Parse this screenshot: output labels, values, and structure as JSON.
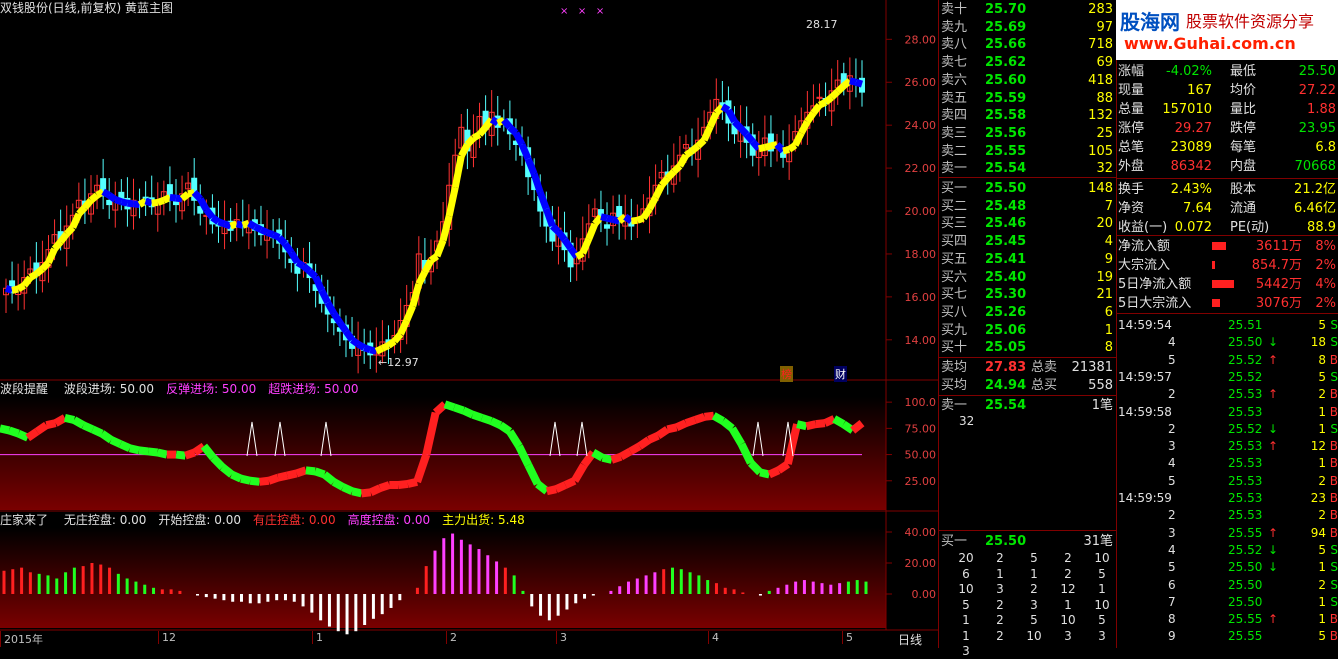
{
  "chart_title": "双钱股份(日线,前复权) 黄蓝主图",
  "main_axis": [
    "28.00",
    "26.00",
    "24.00",
    "22.00",
    "20.00",
    "18.00",
    "16.00",
    "14.00"
  ],
  "high_label": "28.17",
  "low_label": "12.97",
  "badges": [
    "榜",
    "财"
  ],
  "ind1": {
    "name": "波段提醒",
    "items": [
      {
        "t": "波段进场: 50.00",
        "c": "#e0e0e0"
      },
      {
        "t": "反弹进场: 50.00",
        "c": "#ff40ff"
      },
      {
        "t": "超跌进场: 50.00",
        "c": "#ff40ff"
      }
    ],
    "axis": [
      "100.0",
      "75.00",
      "50.00",
      "25.00"
    ]
  },
  "ind2": {
    "name": "庄家来了",
    "items": [
      {
        "t": "无庄控盘: 0.00",
        "c": "#e0e0e0"
      },
      {
        "t": "开始控盘: 0.00",
        "c": "#e0e0e0"
      },
      {
        "t": "有庄控盘: 0.00",
        "c": "#ff3030"
      },
      {
        "t": "高度控盘: 0.00",
        "c": "#ff40ff"
      },
      {
        "t": "主力出货: 5.48",
        "c": "#ffff00"
      }
    ],
    "axis": [
      "40.00",
      "20.00",
      "0.00"
    ]
  },
  "time_axis": {
    "labels": [
      "2015年",
      "12",
      "1",
      "2",
      "3",
      "4",
      "5"
    ],
    "period": "日线"
  },
  "logo": {
    "title": "股海网",
    "subtitle": "股票软件资源分享",
    "url": "www.Guhai.com.cn"
  },
  "sell": [
    {
      "l": "卖十",
      "p": "25.70",
      "v": "283"
    },
    {
      "l": "卖九",
      "p": "25.69",
      "v": "97"
    },
    {
      "l": "卖八",
      "p": "25.66",
      "v": "718"
    },
    {
      "l": "卖七",
      "p": "25.62",
      "v": "69"
    },
    {
      "l": "卖六",
      "p": "25.60",
      "v": "418"
    },
    {
      "l": "卖五",
      "p": "25.59",
      "v": "88"
    },
    {
      "l": "卖四",
      "p": "25.58",
      "v": "132"
    },
    {
      "l": "卖三",
      "p": "25.56",
      "v": "25"
    },
    {
      "l": "卖二",
      "p": "25.55",
      "v": "105"
    },
    {
      "l": "卖一",
      "p": "25.54",
      "v": "32"
    }
  ],
  "buy": [
    {
      "l": "买一",
      "p": "25.50",
      "v": "148"
    },
    {
      "l": "买二",
      "p": "25.48",
      "v": "7"
    },
    {
      "l": "买三",
      "p": "25.46",
      "v": "20"
    },
    {
      "l": "买四",
      "p": "25.45",
      "v": "4"
    },
    {
      "l": "买五",
      "p": "25.41",
      "v": "9"
    },
    {
      "l": "买六",
      "p": "25.40",
      "v": "19"
    },
    {
      "l": "买七",
      "p": "25.30",
      "v": "21"
    },
    {
      "l": "买八",
      "p": "25.26",
      "v": "6"
    },
    {
      "l": "买九",
      "p": "25.06",
      "v": "1"
    },
    {
      "l": "买十",
      "p": "25.05",
      "v": "8"
    }
  ],
  "avg": [
    {
      "l": "卖均",
      "p": "27.83",
      "l2": "总卖",
      "v": "21381"
    },
    {
      "l": "买均",
      "p": "24.94",
      "l2": "总买",
      "v": "558"
    }
  ],
  "sell1_queue": {
    "l": "卖一",
    "p": "25.54",
    "v": "1笔",
    "q": "32"
  },
  "buy1_queue": {
    "l": "买一",
    "p": "25.50",
    "v": "31笔",
    "rows": [
      [
        "20",
        "2",
        "5",
        "2",
        "10"
      ],
      [
        "6",
        "1",
        "1",
        "2",
        "5"
      ],
      [
        "10",
        "3",
        "2",
        "12",
        "1"
      ],
      [
        "5",
        "2",
        "3",
        "1",
        "10"
      ],
      [
        "1",
        "2",
        "5",
        "10",
        "5"
      ],
      [
        "1",
        "2",
        "10",
        "3",
        "3"
      ],
      [
        "3",
        "",
        "",
        "",
        ""
      ]
    ]
  },
  "stats": [
    [
      {
        "t": "涨幅",
        "c": "white"
      },
      {
        "t": "-4.02%",
        "c": "green"
      },
      {
        "t": "最低",
        "c": "white"
      },
      {
        "t": "25.50",
        "c": "green"
      }
    ],
    [
      {
        "t": "现量",
        "c": "white"
      },
      {
        "t": "167",
        "c": "yel"
      },
      {
        "t": "均价",
        "c": "white"
      },
      {
        "t": "27.22",
        "c": "red"
      }
    ],
    [
      {
        "t": "总量",
        "c": "white"
      },
      {
        "t": "157010",
        "c": "yel"
      },
      {
        "t": "量比",
        "c": "white"
      },
      {
        "t": "1.88",
        "c": "red"
      }
    ],
    [
      {
        "t": "涨停",
        "c": "white"
      },
      {
        "t": "29.27",
        "c": "red"
      },
      {
        "t": "跌停",
        "c": "white"
      },
      {
        "t": "23.95",
        "c": "green"
      }
    ],
    [
      {
        "t": "总笔",
        "c": "white"
      },
      {
        "t": "23089",
        "c": "yel"
      },
      {
        "t": "每笔",
        "c": "white"
      },
      {
        "t": "6.8",
        "c": "yel"
      }
    ],
    [
      {
        "t": "外盘",
        "c": "white"
      },
      {
        "t": "86342",
        "c": "red"
      },
      {
        "t": "内盘",
        "c": "white"
      },
      {
        "t": "70668",
        "c": "green"
      }
    ],
    [
      {
        "t": "换手",
        "c": "white"
      },
      {
        "t": "2.43%",
        "c": "yel"
      },
      {
        "t": "股本",
        "c": "white"
      },
      {
        "t": "21.2亿",
        "c": "yel"
      }
    ],
    [
      {
        "t": "净资",
        "c": "white"
      },
      {
        "t": "7.64",
        "c": "yel"
      },
      {
        "t": "流通",
        "c": "white"
      },
      {
        "t": "6.46亿",
        "c": "yel"
      }
    ],
    [
      {
        "t": "收益(一)",
        "c": "white"
      },
      {
        "t": "0.072",
        "c": "yel"
      },
      {
        "t": "PE(动)",
        "c": "white"
      },
      {
        "t": "88.9",
        "c": "yel"
      }
    ]
  ],
  "flows": [
    {
      "l": "净流入额",
      "v": "3611万",
      "p": "8%",
      "w": 14
    },
    {
      "l": "大宗流入",
      "v": "854.7万",
      "p": "2%",
      "w": 3
    },
    {
      "l": "5日净流入额",
      "v": "5442万",
      "p": "4%",
      "w": 22
    },
    {
      "l": "5日大宗流入",
      "v": "3076万",
      "p": "2%",
      "w": 8
    }
  ],
  "ticks": [
    {
      "t": "14:59:54",
      "p": "25.51",
      "a": "",
      "v": "5",
      "s": "S"
    },
    {
      "t": "4",
      "p": "25.50",
      "a": "↓",
      "v": "18",
      "s": "S"
    },
    {
      "t": "5",
      "p": "25.52",
      "a": "↑",
      "v": "8",
      "s": "B"
    },
    {
      "t": "14:59:57",
      "p": "25.52",
      "a": "",
      "v": "5",
      "s": "S"
    },
    {
      "t": "2",
      "p": "25.53",
      "a": "↑",
      "v": "2",
      "s": "B"
    },
    {
      "t": "14:59:58",
      "p": "25.53",
      "a": "",
      "v": "1",
      "s": "B"
    },
    {
      "t": "2",
      "p": "25.52",
      "a": "↓",
      "v": "1",
      "s": "S"
    },
    {
      "t": "3",
      "p": "25.53",
      "a": "↑",
      "v": "12",
      "s": "B"
    },
    {
      "t": "4",
      "p": "25.53",
      "a": "",
      "v": "1",
      "s": "B"
    },
    {
      "t": "5",
      "p": "25.53",
      "a": "",
      "v": "2",
      "s": "B"
    },
    {
      "t": "14:59:59",
      "p": "25.53",
      "a": "",
      "v": "23",
      "s": "B"
    },
    {
      "t": "2",
      "p": "25.53",
      "a": "",
      "v": "2",
      "s": "B"
    },
    {
      "t": "3",
      "p": "25.55",
      "a": "↑",
      "v": "94",
      "s": "B"
    },
    {
      "t": "4",
      "p": "25.52",
      "a": "↓",
      "v": "5",
      "s": "S"
    },
    {
      "t": "5",
      "p": "25.50",
      "a": "↓",
      "v": "1",
      "s": "S"
    },
    {
      "t": "6",
      "p": "25.50",
      "a": "",
      "v": "2",
      "s": "S"
    },
    {
      "t": "7",
      "p": "25.50",
      "a": "",
      "v": "1",
      "s": "S"
    },
    {
      "t": "8",
      "p": "25.55",
      "a": "↑",
      "v": "1",
      "s": "B"
    },
    {
      "t": "9",
      "p": "25.55",
      "a": "",
      "v": "5",
      "s": "B"
    }
  ],
  "colors": {
    "up": "#ff3232",
    "down": "#54ffff",
    "yellow": "#ffff00",
    "blue": "#0000ff",
    "frame": "#800000"
  },
  "chart_data": {
    "type": "candlestick",
    "price_range": [
      12.5,
      28.9
    ],
    "closes": [
      16.4,
      16.2,
      16.5,
      16.9,
      17.3,
      17.0,
      17.6,
      18.2,
      18.9,
      18.6,
      19.3,
      19.8,
      20.5,
      20.2,
      20.8,
      21.2,
      20.7,
      20.3,
      20.6,
      20.4,
      20.1,
      20.5,
      20.3,
      20.6,
      20.2,
      20.4,
      20.9,
      20.6,
      20.3,
      20.8,
      21.3,
      20.5,
      19.9,
      19.8,
      19.4,
      19.3,
      19.5,
      19.1,
      19.6,
      19.3,
      19.4,
      19.1,
      18.9,
      19.0,
      18.8,
      18.5,
      18.1,
      17.6,
      17.1,
      17.6,
      16.9,
      16.3,
      15.7,
      15.2,
      14.8,
      14.4,
      14.0,
      13.6,
      13.8,
      13.5,
      13.3,
      13.6,
      13.9,
      13.7,
      14.2,
      14.9,
      15.6,
      16.2,
      18.0,
      17.3,
      17.8,
      18.6,
      19.5,
      21.2,
      22.6,
      23.9,
      22.8,
      23.5,
      24.4,
      23.8,
      24.6,
      23.9,
      24.2,
      23.6,
      23.1,
      22.6,
      21.6,
      21.0,
      20.0,
      19.3,
      18.6,
      19.2,
      18.2,
      17.4,
      18.0,
      18.7,
      19.4,
      20.1,
      19.7,
      19.2,
      19.9,
      19.5,
      19.8,
      19.3,
      19.6,
      20.1,
      20.6,
      21.2,
      21.8,
      21.6,
      22.1,
      22.6,
      23.1,
      22.7,
      23.3,
      23.9,
      24.6,
      25.2,
      24.8,
      24.1,
      23.6,
      23.9,
      23.2,
      22.6,
      22.9,
      23.4,
      22.8,
      23.1,
      22.5,
      23.0,
      23.7,
      24.2,
      24.6,
      24.9,
      25.3,
      25.0,
      25.6,
      26.1,
      25.8,
      26.3,
      25.9,
      25.54
    ],
    "oscillator": [
      75,
      73,
      70,
      66,
      72,
      78,
      80,
      85,
      83,
      78,
      74,
      70,
      64,
      60,
      56,
      54,
      53,
      52,
      50,
      50,
      49,
      52,
      58,
      47,
      38,
      31,
      27,
      25,
      24,
      25,
      28,
      30,
      32,
      35,
      34,
      31,
      24,
      19,
      15,
      13,
      14,
      18,
      21,
      21,
      22,
      24,
      50,
      90,
      98,
      95,
      92,
      88,
      85,
      82,
      78,
      72,
      58,
      40,
      22,
      15,
      17,
      21,
      25,
      40,
      52,
      47,
      45,
      48,
      53,
      58,
      64,
      68,
      74,
      76,
      80,
      83,
      86,
      87,
      82,
      75,
      60,
      42,
      33,
      31,
      35,
      41,
      79,
      77,
      79,
      80,
      84,
      79,
      73,
      80
    ],
    "histogram": [
      15,
      16,
      17,
      14,
      13,
      12,
      10,
      14,
      17,
      18,
      20,
      19,
      17,
      13,
      10,
      8,
      6,
      4,
      3,
      3,
      2,
      0,
      -1,
      -2,
      -3,
      -4,
      -5,
      -5,
      -6,
      -6,
      -5,
      -4,
      -4,
      -5,
      -8,
      -12,
      -17,
      -21,
      -24,
      -26,
      -24,
      -20,
      -16,
      -13,
      -9,
      -4,
      0,
      4,
      18,
      28,
      36,
      39,
      35,
      32,
      29,
      25,
      21,
      17,
      12,
      2,
      -8,
      -14,
      -17,
      -14,
      -10,
      -6,
      -3,
      -1,
      0,
      2,
      5,
      8,
      10,
      12,
      14,
      16,
      17,
      16,
      14,
      12,
      9,
      7,
      4,
      3,
      1,
      0,
      -1,
      2,
      4,
      6,
      8,
      9,
      8,
      7,
      6,
      7,
      8,
      9,
      8
    ]
  }
}
